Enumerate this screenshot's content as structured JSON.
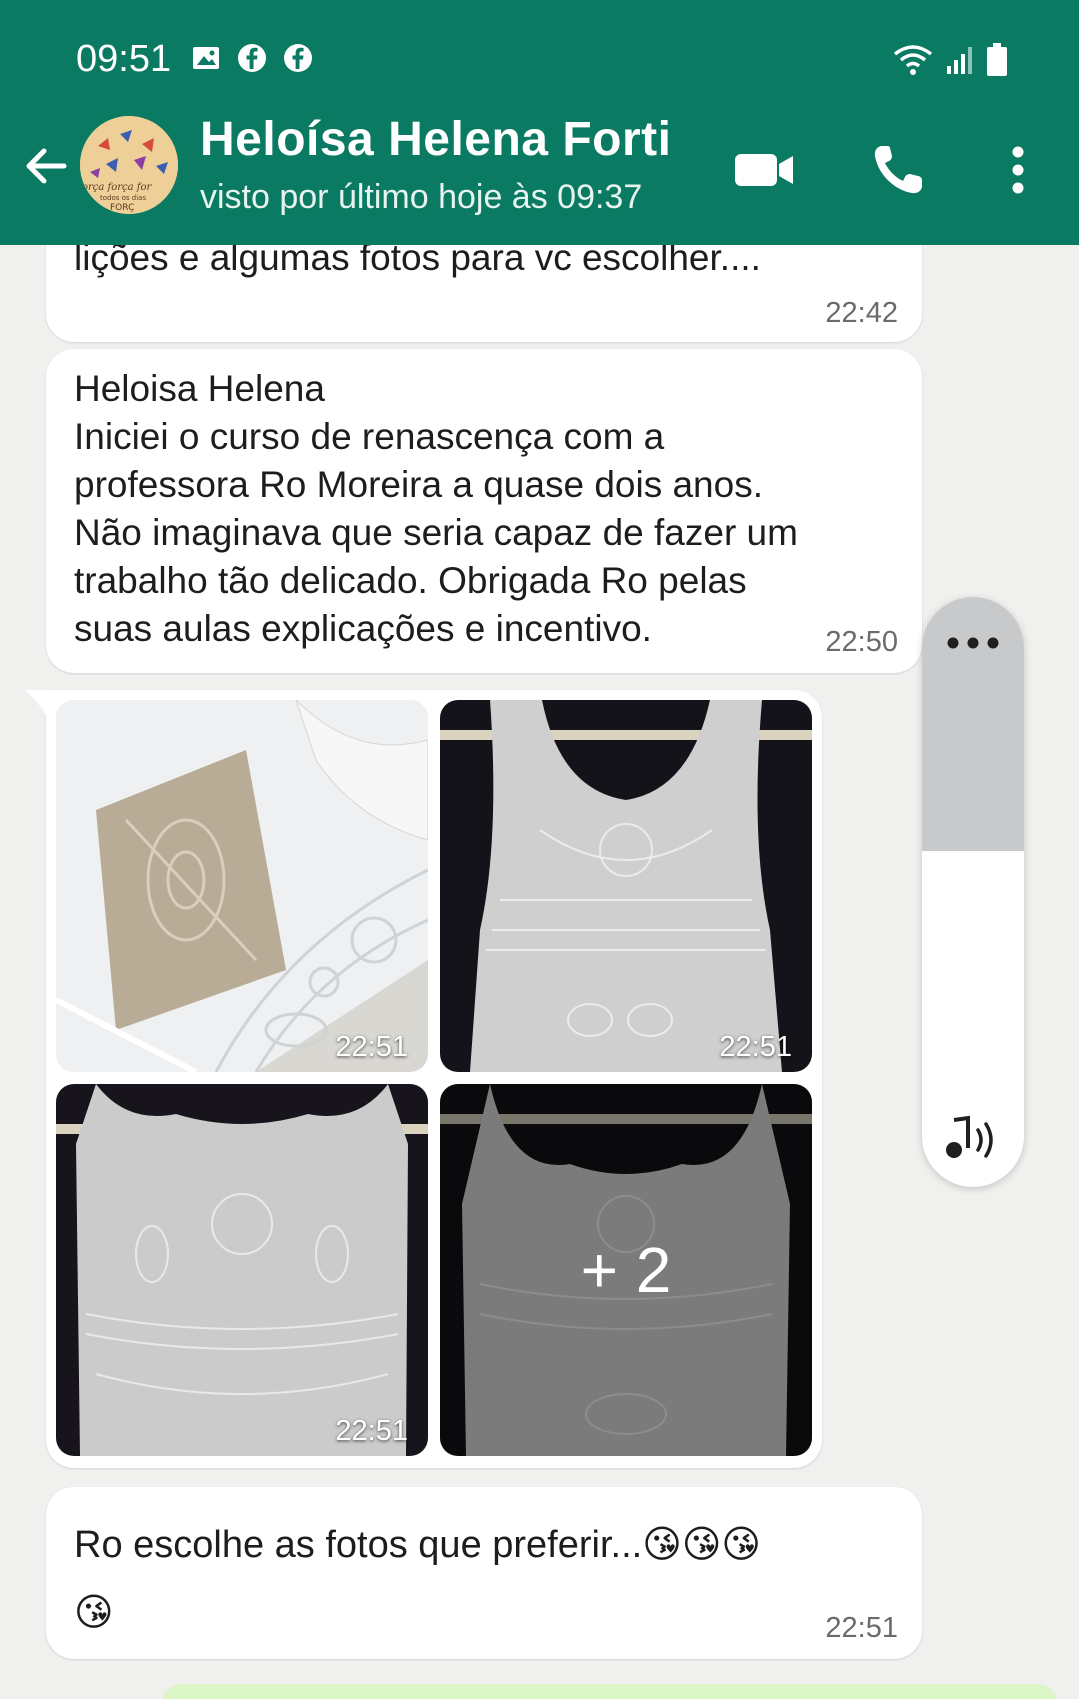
{
  "status_bar": {
    "time": "09:51"
  },
  "header": {
    "contact_name": "Heloísa Helena Forti",
    "last_seen": "visto por último hoje às 09:37",
    "avatar_text": "força força força todos os dias FORÇA"
  },
  "messages": [
    {
      "text": "lições e algumas fotos para vc escolher....",
      "time": "22:42"
    },
    {
      "text": "Heloisa Helena\nIniciei o curso de renascença com a\nprofessora Ro Moreira a quase dois anos.\nNão imaginava que seria capaz de fazer um\ntrabalho tão delicado. Obrigada Ro pelas\nsuas aulas explicações  e incentivo.",
      "time": "22:50"
    },
    {
      "photos": [
        {
          "time": "22:51"
        },
        {
          "time": "22:51"
        },
        {
          "time": "22:51"
        },
        {
          "time": "",
          "more": "+ 2"
        }
      ]
    },
    {
      "text": "Ro escolhe as fotos que preferir...😘😘😘\n😘",
      "time": "22:51"
    }
  ],
  "volume_panel": {
    "level": 0.43,
    "menu_icon": "more-dots-icon",
    "sound_icon": "sound-icon"
  },
  "colors": {
    "header": "#0b7a63",
    "background": "#f0f1ee",
    "bubble": "#ffffff"
  }
}
